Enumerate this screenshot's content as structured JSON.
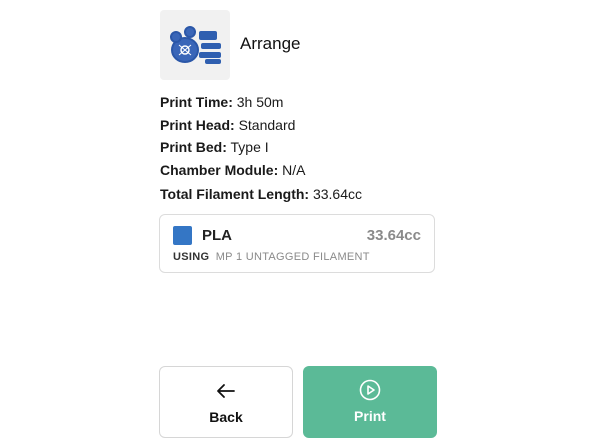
{
  "job": {
    "name": "Arrange",
    "thumbnail_icon": "build-plate-thumbnail"
  },
  "details": [
    {
      "label": "Print Time:",
      "value": "3h 50m"
    },
    {
      "label": "Print Head:",
      "value": "Standard"
    },
    {
      "label": "Print Bed:",
      "value": "Type I"
    },
    {
      "label": "Chamber Module:",
      "value": "N/A"
    }
  ],
  "total_filament": {
    "label": "Total Filament Length:",
    "value": "33.64cc"
  },
  "filament": {
    "material": "PLA",
    "amount": "33.64cc",
    "color": "#3476c5",
    "using_label": "USING",
    "source": "MP 1 UNTAGGED FILAMENT"
  },
  "actions": {
    "back": {
      "label": "Back",
      "icon": "arrow-left-icon"
    },
    "print": {
      "label": "Print",
      "icon": "play-circle-icon",
      "color": "#5bba97"
    }
  }
}
